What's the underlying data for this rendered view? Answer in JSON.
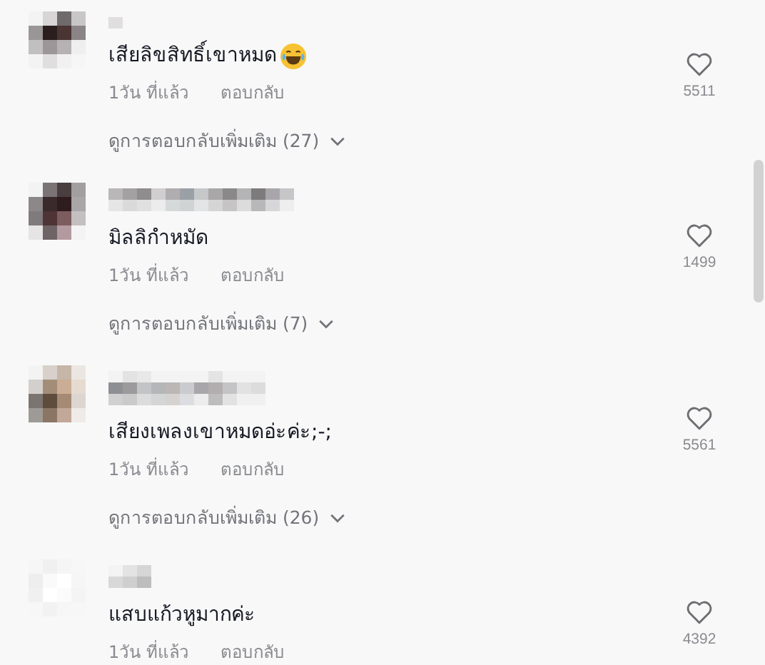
{
  "comments": [
    {
      "text": "เสียลิขสิทธิ์เขาหมด",
      "laugh_emoji": true,
      "time": "1วัน ที่แล้ว",
      "reply": "ตอบกลับ",
      "likes": "5511",
      "more_replies": "ดูการตอบกลับเพิ่มเติม (27)"
    },
    {
      "text": "มิลลิกำหมัด",
      "time": "1วัน ที่แล้ว",
      "reply": "ตอบกลับ",
      "likes": "1499",
      "more_replies": "ดูการตอบกลับเพิ่มเติม (7)"
    },
    {
      "text": "เสียงเพลงเขาหมดอ่ะค่ะ;-;",
      "time": "1วัน ที่แล้ว",
      "reply": "ตอบกลับ",
      "likes": "5561",
      "more_replies": "ดูการตอบกลับเพิ่มเติม (26)"
    },
    {
      "text": "แสบแก้วหูมากค่ะ",
      "time": "1วัน ที่แล้ว",
      "reply": "ตอบกลับ",
      "likes": "4392"
    }
  ]
}
